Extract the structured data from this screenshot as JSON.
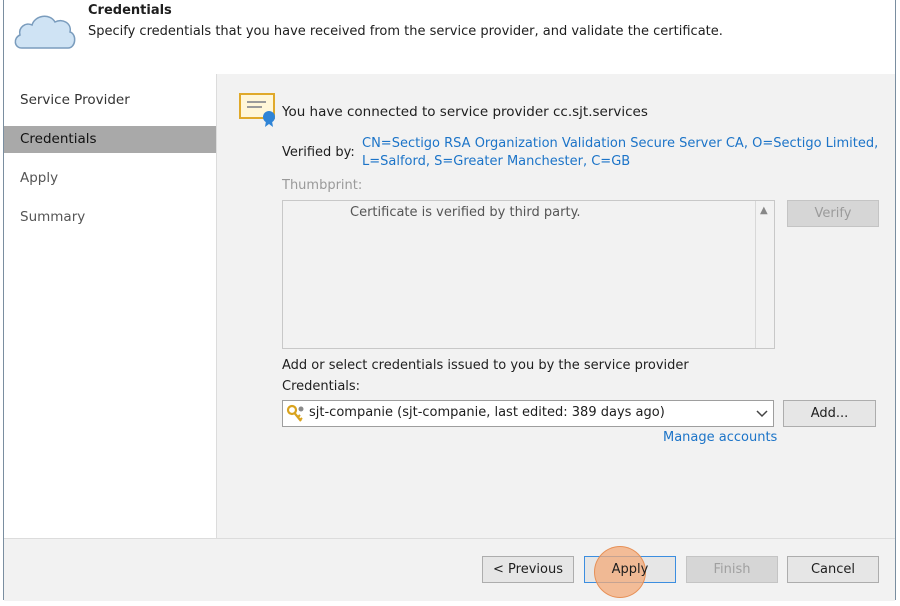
{
  "header": {
    "title": "Credentials",
    "description": "Specify credentials that you have received from the service provider, and validate the certificate."
  },
  "sidebar": {
    "items": [
      {
        "label": "Service Provider"
      },
      {
        "label": "Credentials",
        "active": true
      },
      {
        "label": "Apply"
      },
      {
        "label": "Summary"
      }
    ]
  },
  "main": {
    "connected_text": "You have connected to service provider cc.sjt.services",
    "verified_label": "Verified by:",
    "verified_value_line1": "CN=Sectigo RSA Organization Validation Secure Server CA, O=Sectigo Limited,",
    "verified_value_line2": "L=Salford, S=Greater Manchester, C=GB",
    "thumbprint_label": "Thumbprint:",
    "thumbprint_text": "Certificate is verified by third party.",
    "verify_label": "Verify",
    "add_select_label": "Add or select credentials issued to you by the service provider",
    "credentials_label": "Credentials:",
    "credentials_value": "sjt-companie (sjt-companie, last edited: 389 days ago)",
    "add_label": "Add...",
    "manage_accounts": "Manage accounts"
  },
  "footer": {
    "previous": "< Previous",
    "apply": "Apply",
    "finish": "Finish",
    "cancel": "Cancel"
  },
  "colors": {
    "link": "#1c74c8",
    "sidebar_active": "#a9a9a9",
    "click_indicator": "#f3aa78"
  }
}
